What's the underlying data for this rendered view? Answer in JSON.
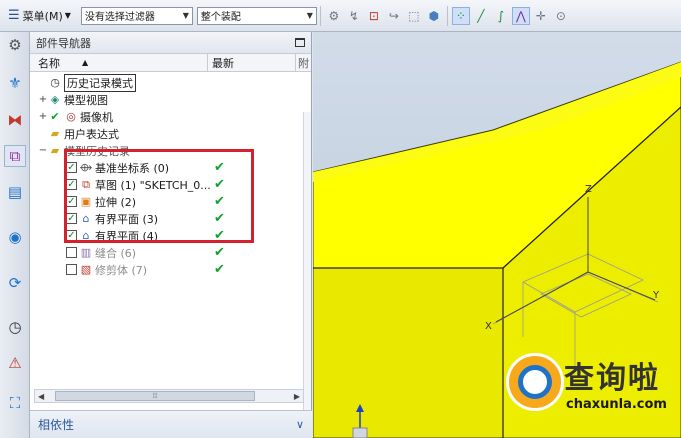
{
  "toolbar": {
    "menu_label": "菜单(M)",
    "filter_value": "没有选择过滤器",
    "assembly_value": "整个装配"
  },
  "panel": {
    "title": "部件导航器",
    "columns": {
      "name": "名称",
      "latest": "最新",
      "extra": "附"
    }
  },
  "tree": {
    "history_mode": "历史记录模式",
    "model_views": "模型视图",
    "cameras": "摄像机",
    "user_expressions": "用户表达式",
    "model_history": "模型历史记录",
    "features": [
      {
        "label": "基准坐标系 (0)"
      },
      {
        "label": "草图 (1) \"SKETCH_0..."
      },
      {
        "label": "拉伸 (2)"
      },
      {
        "label": "有界平面 (3)"
      },
      {
        "label": "有界平面 (4)"
      },
      {
        "label": "缝合 (6)"
      },
      {
        "label": "修剪体 (7)"
      }
    ]
  },
  "dependents": {
    "label": "相依性"
  },
  "viewport": {
    "axes": {
      "x_label": "X",
      "y_label": "Y",
      "z_label": "Z"
    },
    "colors": {
      "solid_face": "#ffff00",
      "highlight": "#d3212e"
    }
  },
  "watermark": {
    "name": "查询啦",
    "url": "chaxunla.com"
  }
}
